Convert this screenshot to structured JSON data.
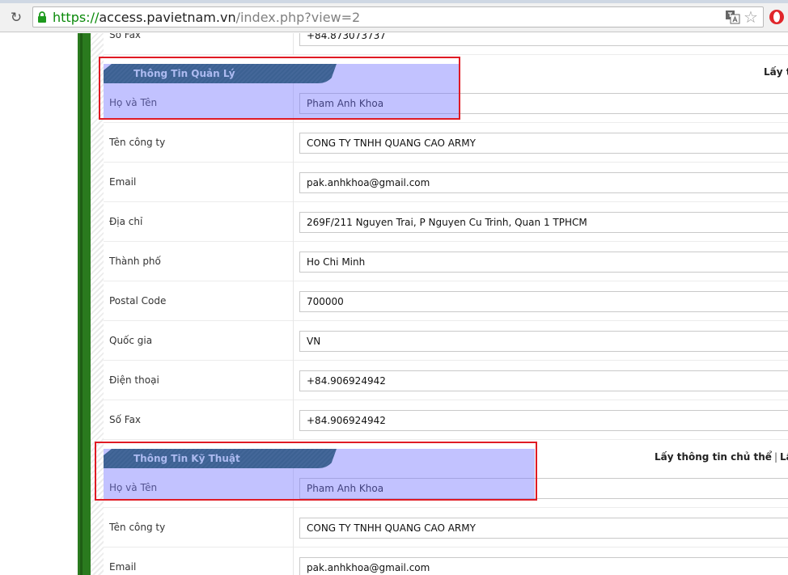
{
  "browser": {
    "url_scheme": "https://",
    "url_host": "access.pavietnam.vn",
    "url_rest": "/index.php?view=2"
  },
  "top_row": {
    "label": "Số Fax",
    "value": "+84.873073737"
  },
  "admin": {
    "title": "Thông Tin Quản Lý",
    "link_partial": "Lấy t",
    "rows": [
      {
        "label": "Họ và Tên",
        "value": "Pham Anh Khoa"
      },
      {
        "label": "Tên công ty",
        "value": "CONG TY TNHH QUANG CAO ARMY"
      },
      {
        "label": "Email",
        "value": "pak.anhkhoa@gmail.com"
      },
      {
        "label": "Địa chỉ",
        "value": "269F/211 Nguyen Trai, P Nguyen Cu Trinh, Quan 1 TPHCM"
      },
      {
        "label": "Thành phố",
        "value": "Ho Chi Minh"
      },
      {
        "label": "Postal Code",
        "value": "700000"
      },
      {
        "label": "Quốc gia",
        "value": "VN"
      },
      {
        "label": "Điện thoại",
        "value": "+84.906924942"
      },
      {
        "label": "Số Fax",
        "value": "+84.906924942"
      }
    ]
  },
  "tech": {
    "title": "Thông Tin Kỹ Thuật",
    "link_owner": "Lấy thông tin chủ thể",
    "link_sep": "|",
    "link_partial": "Lấy t",
    "rows": [
      {
        "label": "Họ và Tên",
        "value": "Pham Anh Khoa"
      },
      {
        "label": "Tên công ty",
        "value": "CONG TY TNHH QUANG CAO ARMY"
      },
      {
        "label": "Email",
        "value": "pak.anhkhoa@gmail.com"
      }
    ]
  },
  "colors": {
    "highlight": "#7878ff",
    "annotation_border": "#e01b24",
    "section_tab": "#0c4f3a",
    "side_bar": "#2a7a1e"
  }
}
